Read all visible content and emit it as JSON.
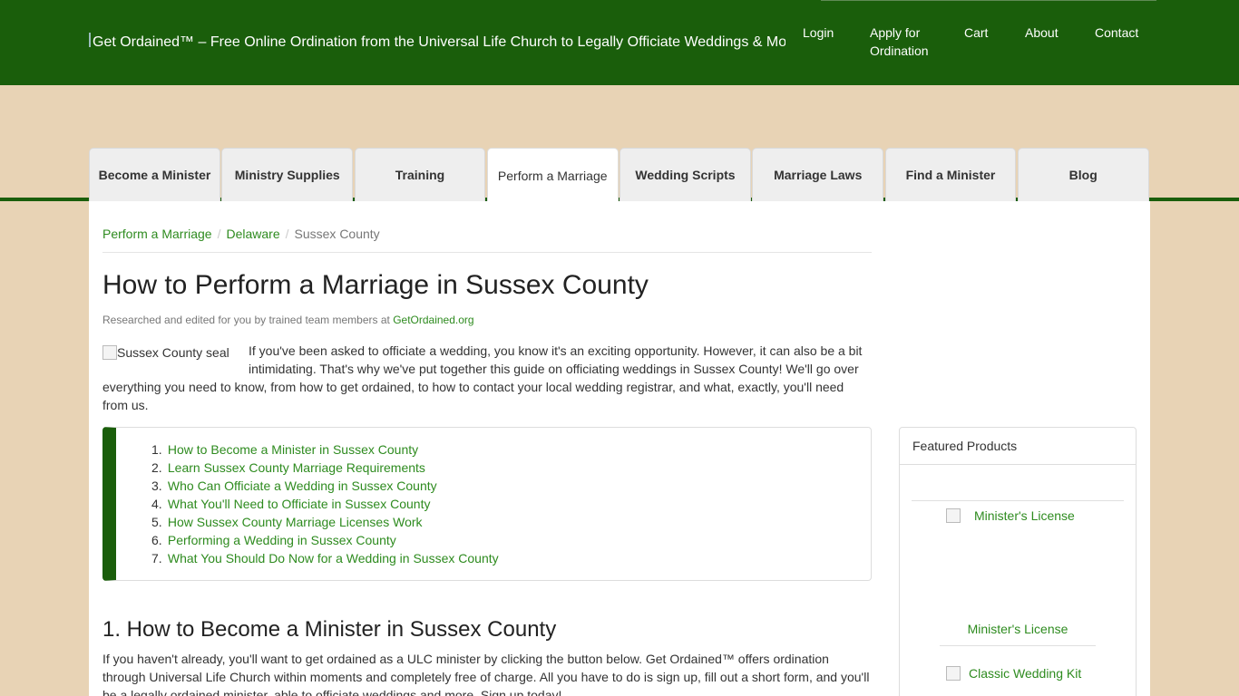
{
  "header": {
    "logo_alt": "Get Ordained™ – Free Online Ordination from the Universal Life Church to Legally Officiate Weddings & More",
    "nav": {
      "login": "Login",
      "apply_line1": "Apply for",
      "apply_line2": "Ordination",
      "cart": "Cart",
      "about": "About",
      "contact": "Contact"
    }
  },
  "tabs": [
    {
      "label": "Become a Minister"
    },
    {
      "label": "Ministry Supplies"
    },
    {
      "label": "Training"
    },
    {
      "label": "Perform a Marriage",
      "active": true
    },
    {
      "label": "Wedding Scripts"
    },
    {
      "label": "Marriage Laws"
    },
    {
      "label": "Find a Minister"
    },
    {
      "label": "Blog"
    }
  ],
  "breadcrumb": {
    "items": [
      "Perform a Marriage",
      "Delaware"
    ],
    "current": "Sussex County",
    "separator": "/"
  },
  "article": {
    "title": "How to Perform a Marriage in Sussex County",
    "byline_text": "Researched and edited for you by trained team members at ",
    "byline_link": "GetOrdained.org",
    "seal_alt": "Sussex County seal",
    "intro": "If you've been asked to officiate a wedding, you know it's an exciting opportunity. However, it can also be a bit intimidating. That's why we've put together this guide on officiating weddings in Sussex County! We'll go over everything you need to know, from how to get ordained, to how to contact your local wedding registrar, and what, exactly, you'll need from us.",
    "toc": [
      {
        "num": "1.",
        "label": "How to Become a Minister in Sussex County"
      },
      {
        "num": "2.",
        "label": "Learn Sussex County Marriage Requirements"
      },
      {
        "num": "3.",
        "label": "Who Can Officiate a Wedding in Sussex County"
      },
      {
        "num": "4.",
        "label": "What You'll Need to Officiate in Sussex County"
      },
      {
        "num": "5.",
        "label": "How Sussex County Marriage Licenses Work"
      },
      {
        "num": "6.",
        "label": "Performing a Wedding in Sussex County"
      },
      {
        "num": "7.",
        "label": "What You Should Do Now for a Wedding in Sussex County"
      }
    ],
    "section1_heading": "1. How to Become a Minister in Sussex County",
    "section1_text": "If you haven't already, you'll want to get ordained as a ULC minister by clicking the button below. Get Ordained™ offers ordination through Universal Life Church within moments and completely free of charge. All you have to do is sign up, fill out a short form, and you'll be a legally ordained minister, able to officiate weddings and more. Sign up today!"
  },
  "sidebar": {
    "heading": "Featured Products",
    "products": [
      {
        "img_alt": "Minister's License",
        "title": "Minister's License"
      },
      {
        "img_alt": "Classic Wedding Kit"
      }
    ]
  },
  "colors": {
    "header_green": "#1a5e0b",
    "background_tan": "#e8d3b5",
    "link_green": "#2e8b1f"
  }
}
